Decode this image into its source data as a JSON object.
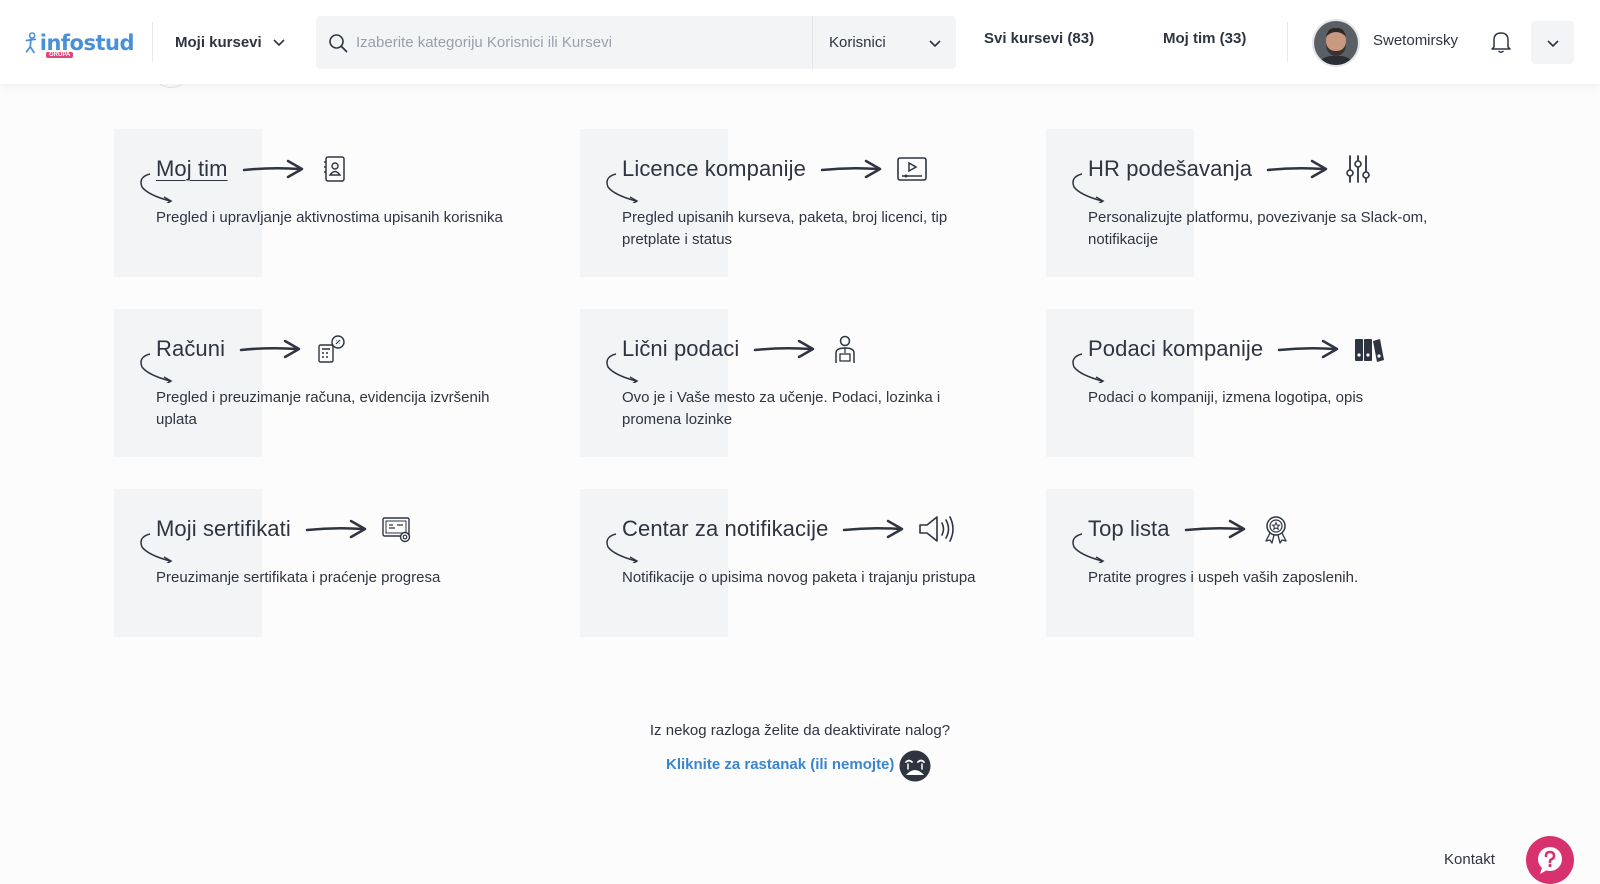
{
  "header": {
    "logo_text": "infostud",
    "logo_sub": "GRUPA",
    "my_courses_label": "Moji kursevi",
    "search_placeholder": "Izaberite kategoriju Korisnici ili Kursevi",
    "search_scope": "Korisnici",
    "all_courses_label": "Svi kursevi (83)",
    "my_team_label": "Moj tim (33)",
    "username": "Swetomirsky"
  },
  "cards": [
    {
      "title": "Moj tim",
      "desc": "Pregled i upravljanje aktivnostima upisanih korisnika",
      "icon": "team-id-icon"
    },
    {
      "title": "Licence kompanije",
      "desc": "Pregled upisanih kurseva, paketa, broj licenci, tip pretplate i status",
      "icon": "video-player-icon"
    },
    {
      "title": "HR podešavanja",
      "desc": "Personalizujte platformu, povezivanje sa Slack-om, notifikacije",
      "icon": "sliders-icon"
    },
    {
      "title": "Računi",
      "desc": "Pregled i preuzimanje računa, evidencija izvršenih uplata",
      "icon": "invoice-calculator-icon"
    },
    {
      "title": "Lični podaci",
      "desc": "Ovo je i Vaše mesto za učenje. Podaci, lozinka i promena lozinke",
      "icon": "person-icon"
    },
    {
      "title": "Podaci kompanije",
      "desc": "Podaci o kompaniji, izmena logotipa, opis",
      "icon": "binders-icon"
    },
    {
      "title": "Moji sertifikati",
      "desc": "Preuzimanje sertifikata i praćenje progresa",
      "icon": "certificate-icon"
    },
    {
      "title": "Centar za notifikacije",
      "desc": "Notifikacije o upisima novog paketa i trajanju pristupa",
      "icon": "speaker-icon"
    },
    {
      "title": "Top lista",
      "desc": "Pratite progres i uspeh vaših zaposlenih.",
      "icon": "award-badge-icon"
    }
  ],
  "footer": {
    "deactivate_question": "Iz nekog razloga želite da deaktivirate nalog?",
    "deactivate_link": "Kliknite za rastanak (ili nemojte)",
    "contact_label": "Kontakt"
  },
  "colors": {
    "accent_blue": "#3a85d0",
    "help_pink": "#d8326e",
    "card_bg": "#f3f4f6"
  }
}
